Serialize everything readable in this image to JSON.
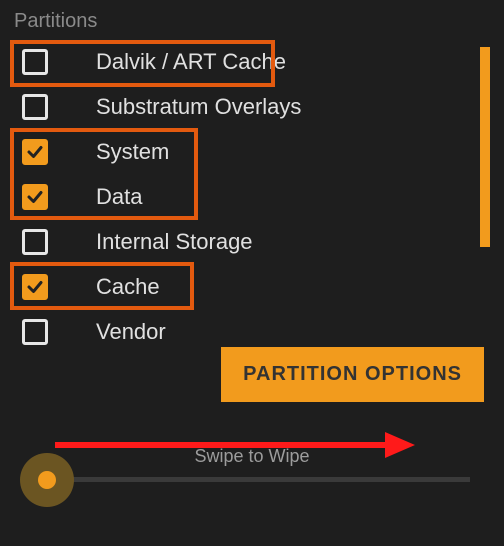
{
  "section_label": "Partitions",
  "partitions": {
    "items": [
      {
        "label": "Dalvik / ART Cache",
        "checked": false
      },
      {
        "label": "Substratum Overlays",
        "checked": false
      },
      {
        "label": "System",
        "checked": true
      },
      {
        "label": "Data",
        "checked": true
      },
      {
        "label": "Internal Storage",
        "checked": false
      },
      {
        "label": "Cache",
        "checked": true
      },
      {
        "label": "Vendor",
        "checked": false
      }
    ]
  },
  "options_button_label": "PARTITION OPTIONS",
  "swipe_label": "Swipe to Wipe"
}
